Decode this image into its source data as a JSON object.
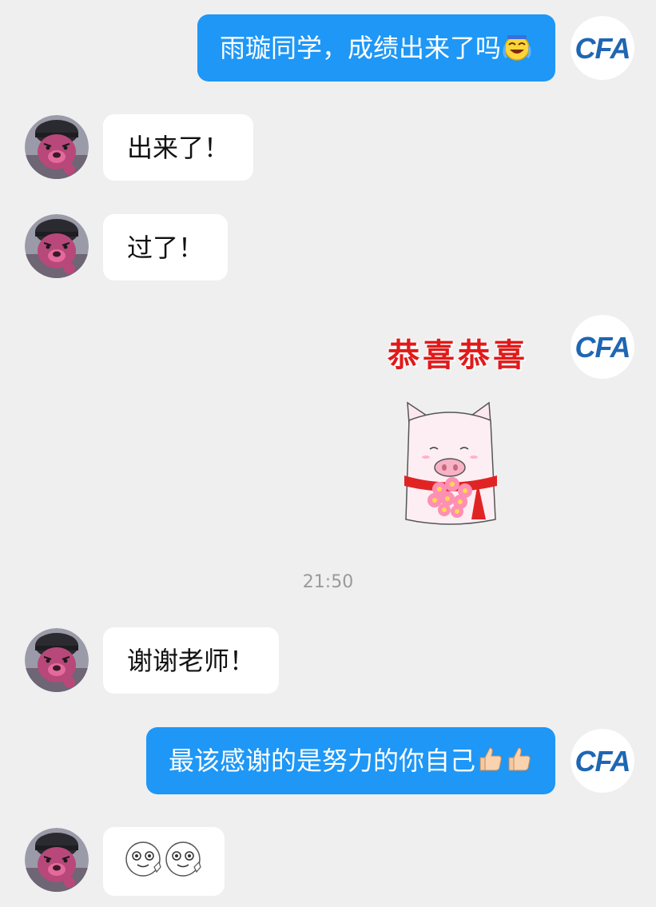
{
  "messages": [
    {
      "side": "right",
      "type": "text",
      "text": "雨璇同学，成绩出来了吗",
      "emoji": "laughing-crying-face-icon"
    },
    {
      "side": "left",
      "type": "text",
      "text": "出来了！"
    },
    {
      "side": "left",
      "type": "text",
      "text": "过了！"
    },
    {
      "side": "right",
      "type": "sticker",
      "text": "恭喜恭喜",
      "sticker_icon": "pig-with-flowers-icon"
    },
    {
      "type": "timestamp",
      "text": "21:50"
    },
    {
      "side": "left",
      "type": "text",
      "text": "谢谢老师！"
    },
    {
      "side": "right",
      "type": "text",
      "text": "最该感谢的是努力的你自己",
      "emoji": "thumbs-up-icon",
      "emoji_count": 2
    },
    {
      "side": "left",
      "type": "emoji",
      "emoji": "smiling-face-icon",
      "emoji_count": 2
    }
  ],
  "cfa_avatar": {
    "label": "CFA"
  },
  "colors": {
    "background": "#efeff0",
    "sent_bubble": "#1e97f6",
    "received_bubble": "#ffffff",
    "cfa_brand": "#1f66b3"
  }
}
